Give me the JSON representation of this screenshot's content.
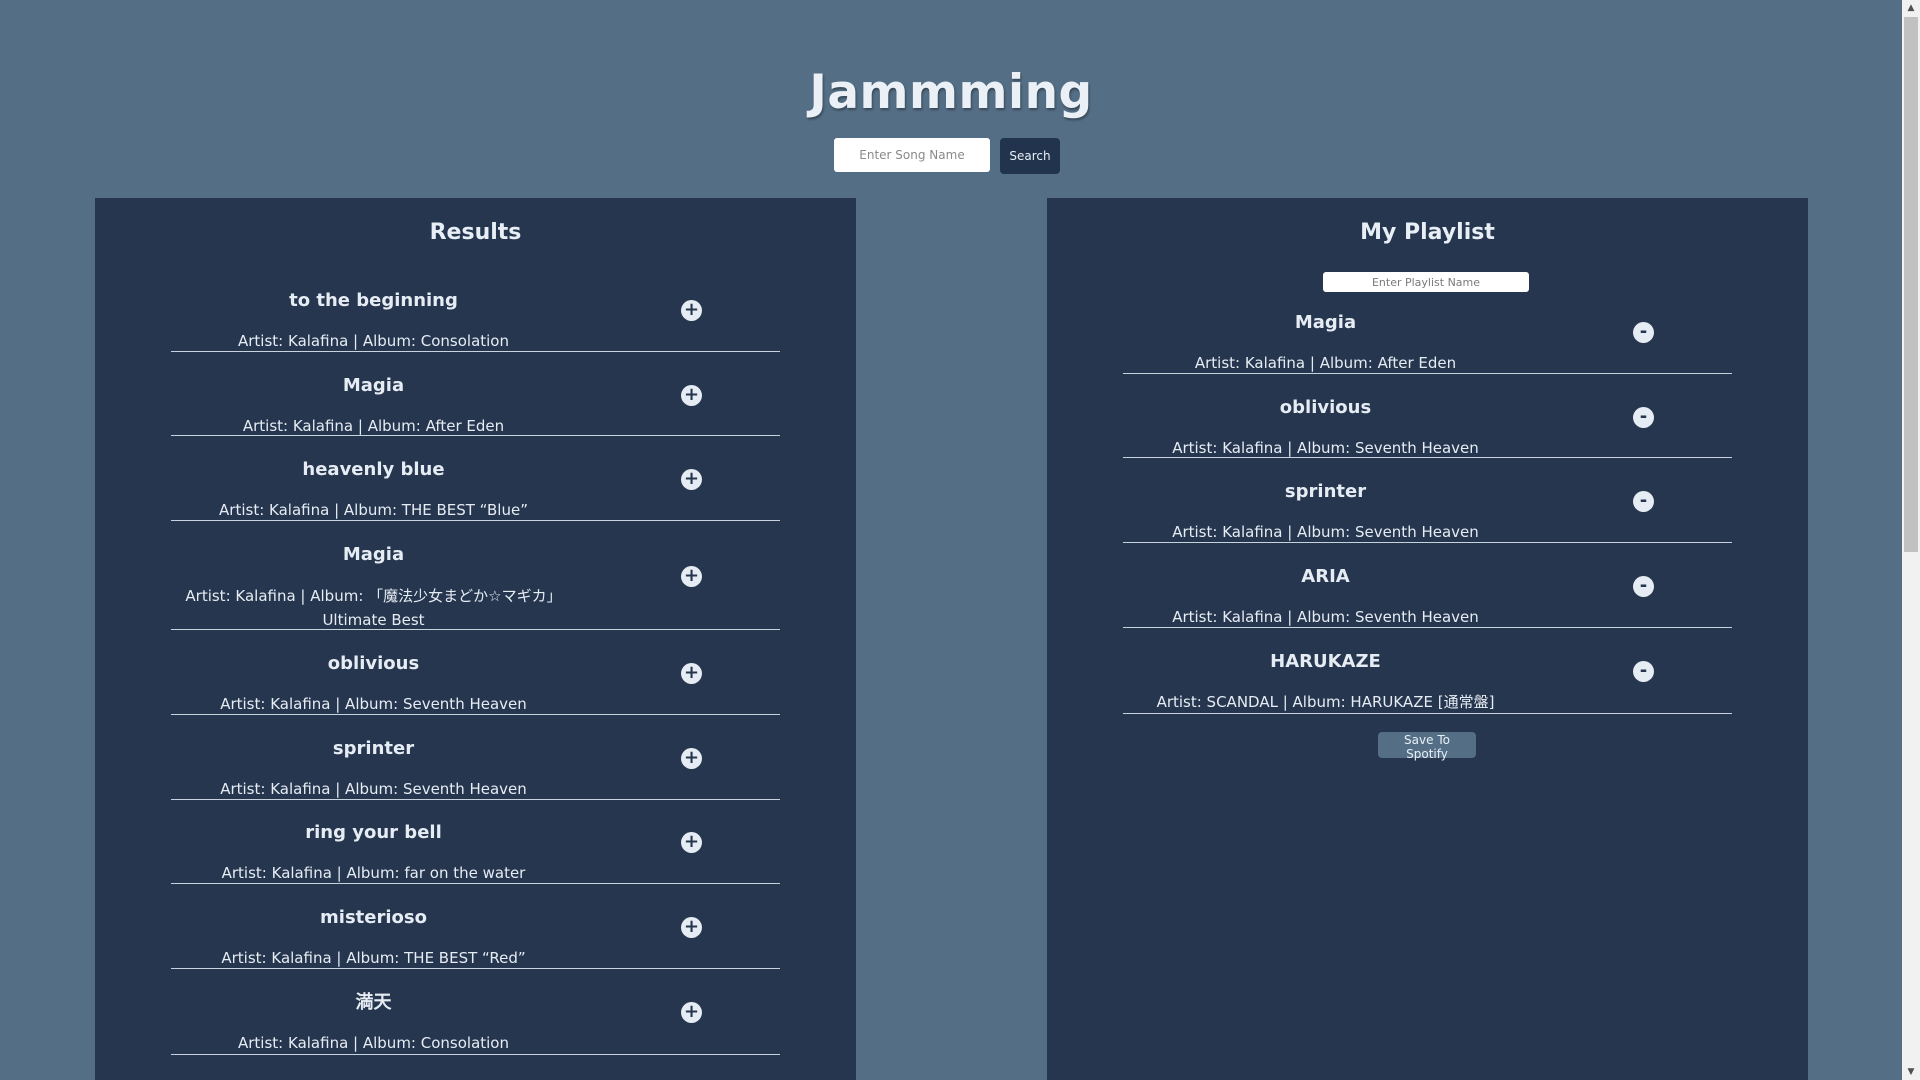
{
  "app": {
    "title": "Jammming"
  },
  "search": {
    "placeholder": "Enter Song Name",
    "button_label": "Search"
  },
  "results": {
    "title": "Results",
    "action_symbol": "+",
    "tracks": [
      {
        "name": "to the beginning",
        "meta": "Artist: Kalafina | Album: Consolation"
      },
      {
        "name": "Magia",
        "meta": "Artist: Kalafina | Album: After Eden"
      },
      {
        "name": "heavenly blue",
        "meta": "Artist: Kalafina | Album: THE BEST “Blue”"
      },
      {
        "name": "Magia",
        "meta": "Artist: Kalafina | Album: 「魔法少女まどか☆マギカ」 Ultimate Best"
      },
      {
        "name": "oblivious",
        "meta": "Artist: Kalafina | Album: Seventh Heaven"
      },
      {
        "name": "sprinter",
        "meta": "Artist: Kalafina | Album: Seventh Heaven"
      },
      {
        "name": "ring your bell",
        "meta": "Artist: Kalafina | Album: far on the water"
      },
      {
        "name": "misterioso",
        "meta": "Artist: Kalafina | Album: THE BEST “Red”"
      },
      {
        "name": "満天",
        "meta": "Artist: Kalafina | Album: Consolation"
      }
    ]
  },
  "playlist": {
    "title": "My Playlist",
    "name_placeholder": "Enter Playlist Name",
    "action_symbol": "-",
    "save_label": "Save To Spotify",
    "tracks": [
      {
        "name": "Magia",
        "meta": "Artist: Kalafina | Album: After Eden"
      },
      {
        "name": "oblivious",
        "meta": "Artist: Kalafina | Album: Seventh Heaven"
      },
      {
        "name": "sprinter",
        "meta": "Artist: Kalafina | Album: Seventh Heaven"
      },
      {
        "name": "ARIA",
        "meta": "Artist: Kalafina | Album: Seventh Heaven"
      },
      {
        "name": "HARUKAZE",
        "meta": "Artist: SCANDAL | Album: HARUKAZE [通常盤]"
      }
    ]
  },
  "colors": {
    "background": "#546e85",
    "panel": "#26364f",
    "text": "#e6ecf3",
    "button_dark": "#22344d"
  }
}
